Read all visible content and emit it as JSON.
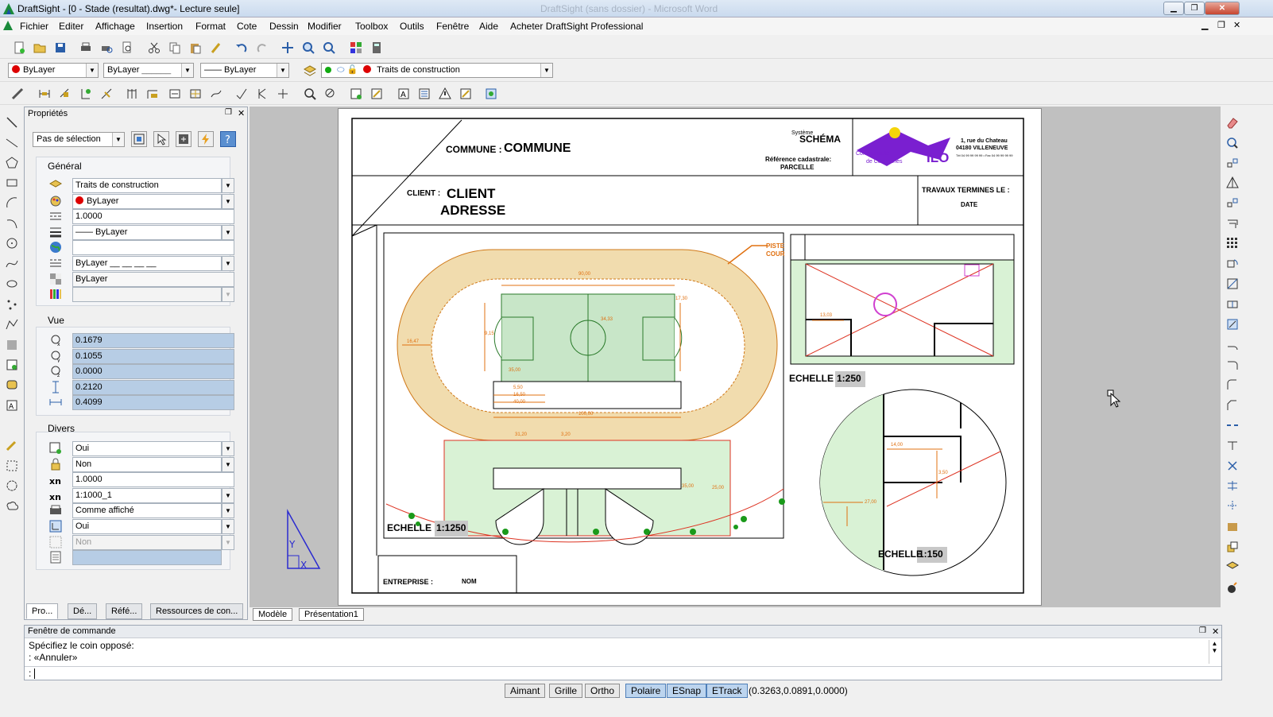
{
  "window": {
    "title": "DraftSight - [0 - Stade (resultat).dwg*- Lecture seule]",
    "ghost_title": "DraftSight (sans dossier) - Microsoft Word",
    "min_icon": "minimize-icon",
    "max_icon": "maximize-icon",
    "close_label": "✕"
  },
  "menu": [
    "Fichier",
    "Editer",
    "Affichage",
    "Insertion",
    "Format",
    "Cote",
    "Dessin",
    "Modifier",
    "Toolbox",
    "Outils",
    "Fenêtre",
    "Aide",
    "Acheter DraftSight Professional"
  ],
  "layer_toolbar": {
    "color_value": "ByLayer",
    "linetype_value": "ByLayer",
    "lineweight_value": "—— ByLayer",
    "layer_value": "Traits de construction",
    "layer_color": "#dd0000",
    "on_color": "#11aa11"
  },
  "properties": {
    "title": "Propriétés",
    "selection": "Pas de sélection",
    "general": {
      "title": "Général",
      "layer": "Traits de construction",
      "color": "ByLayer",
      "linescale": "1.0000",
      "lineweight": "—— ByLayer",
      "empty": "",
      "linetype": "ByLayer",
      "transparency": "ByLayer",
      "pattern": ""
    },
    "view": {
      "title": "Vue",
      "center_x": "0.1679",
      "center_y": "0.1055",
      "center_z": "0.0000",
      "height": "0.2120",
      "width": "0.4099"
    },
    "misc": {
      "title": "Divers",
      "ucs_on": "Oui",
      "locked": "Non",
      "scale": "1.0000",
      "standard_scale": "1:1000_1",
      "shade": "Comme affiché",
      "ucs_origin": "Oui",
      "disabled": "Non",
      "last": ""
    },
    "tabs": [
      "Pro...",
      "Dé...",
      "Réfé...",
      "Ressources de con..."
    ]
  },
  "layout_tabs": [
    "Modèle",
    "Présentation1"
  ],
  "command": {
    "title": "Fenêtre de commande",
    "line1": "Spécifiez le coin opposé:",
    "line2": ": «Annuler»",
    "prompt": ":"
  },
  "status": {
    "buttons": [
      {
        "label": "Aimant",
        "on": false
      },
      {
        "label": "Grille",
        "on": false
      },
      {
        "label": "Ortho",
        "on": false
      },
      {
        "label": "Polaire",
        "on": true
      },
      {
        "label": "ESnap",
        "on": true
      },
      {
        "label": "ETrack",
        "on": true
      }
    ],
    "coords": "(0.3263,0.0891,0.0000)"
  },
  "drawing": {
    "commune_label": "COMMUNE :",
    "commune_value": "COMMUNE",
    "client_label": "CLIENT :",
    "client_value": "CLIENT",
    "address": "ADRESSE",
    "schema_small": "Système",
    "schema": "SCHÉMA",
    "ref_label": "Référence cadastrale:",
    "ref_value": "PARCELLE",
    "logo_line1": "Communauté",
    "logo_line2": "de Communes",
    "logo_ilo": "ILO",
    "addr1": "1, rue du Chateau",
    "addr2": "04180 VILLENEUVE",
    "addr3": "Tél 04 99 99 99 99 • Fax 04 99 99 99 99",
    "travaux": "TRAVAUX TERMINES LE :",
    "date": "DATE",
    "entreprise_label": "ENTREPRISE :",
    "entreprise_value": "NOM",
    "echelle1_label": "ECHELLE",
    "echelle1_value": "1:1250",
    "echelle2_label": "ECHELLE",
    "echelle2_value": "1:250",
    "echelle3_label": "ECHELLE",
    "echelle3_value": "1:150",
    "piste": "PISTE",
    "piste2": "COUR",
    "dims": [
      "90,00",
      "17,30",
      "16,47",
      "9,15",
      "34,33",
      "35,00",
      "100,00",
      "5,50",
      "16,50",
      "40,00",
      "31,20",
      "3,20",
      "35,00",
      "25,00",
      "13,03",
      "14,00",
      "3,50",
      "27,00"
    ]
  }
}
